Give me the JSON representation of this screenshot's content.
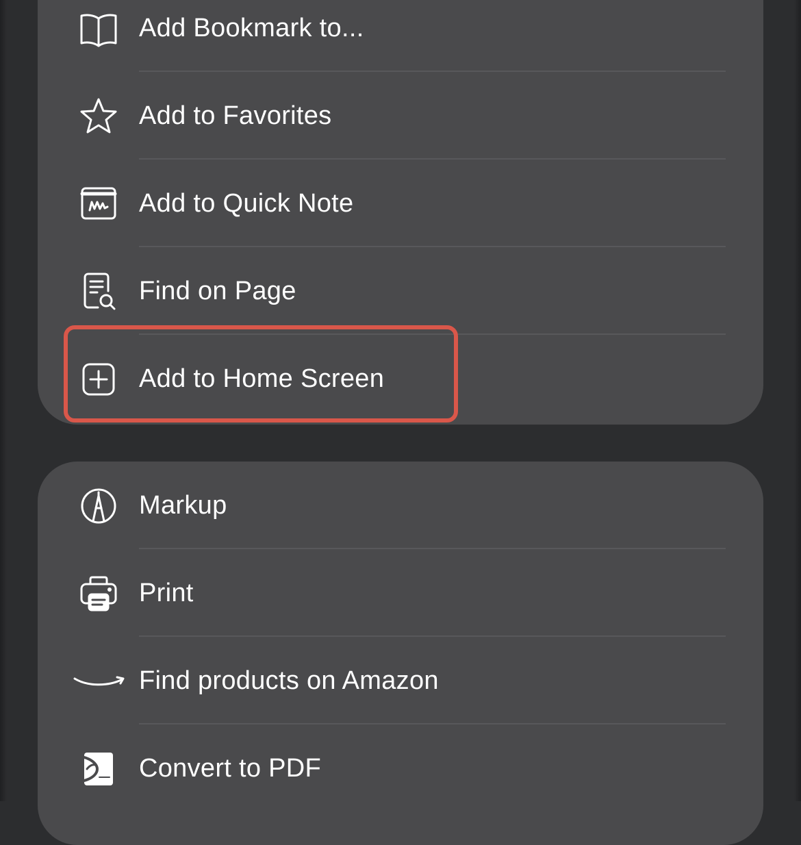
{
  "menu": {
    "group1": [
      {
        "label": "Add Bookmark to...",
        "icon": "book-icon"
      },
      {
        "label": "Add to Favorites",
        "icon": "star-icon"
      },
      {
        "label": "Add to Quick Note",
        "icon": "quick-note-icon"
      },
      {
        "label": "Find on Page",
        "icon": "find-on-page-icon"
      },
      {
        "label": "Add to Home Screen",
        "icon": "add-square-icon"
      }
    ],
    "group2": [
      {
        "label": "Markup",
        "icon": "markup-pen-icon"
      },
      {
        "label": "Print",
        "icon": "printer-icon"
      },
      {
        "label": "Find products on Amazon",
        "icon": "amazon-smile-icon"
      },
      {
        "label": "Convert to PDF",
        "icon": "pdf-convert-icon"
      }
    ]
  },
  "colors": {
    "background": "#2c2d2f",
    "group_background": "#4a4a4c",
    "text": "#ffffff",
    "highlight_border": "#d9574a"
  }
}
